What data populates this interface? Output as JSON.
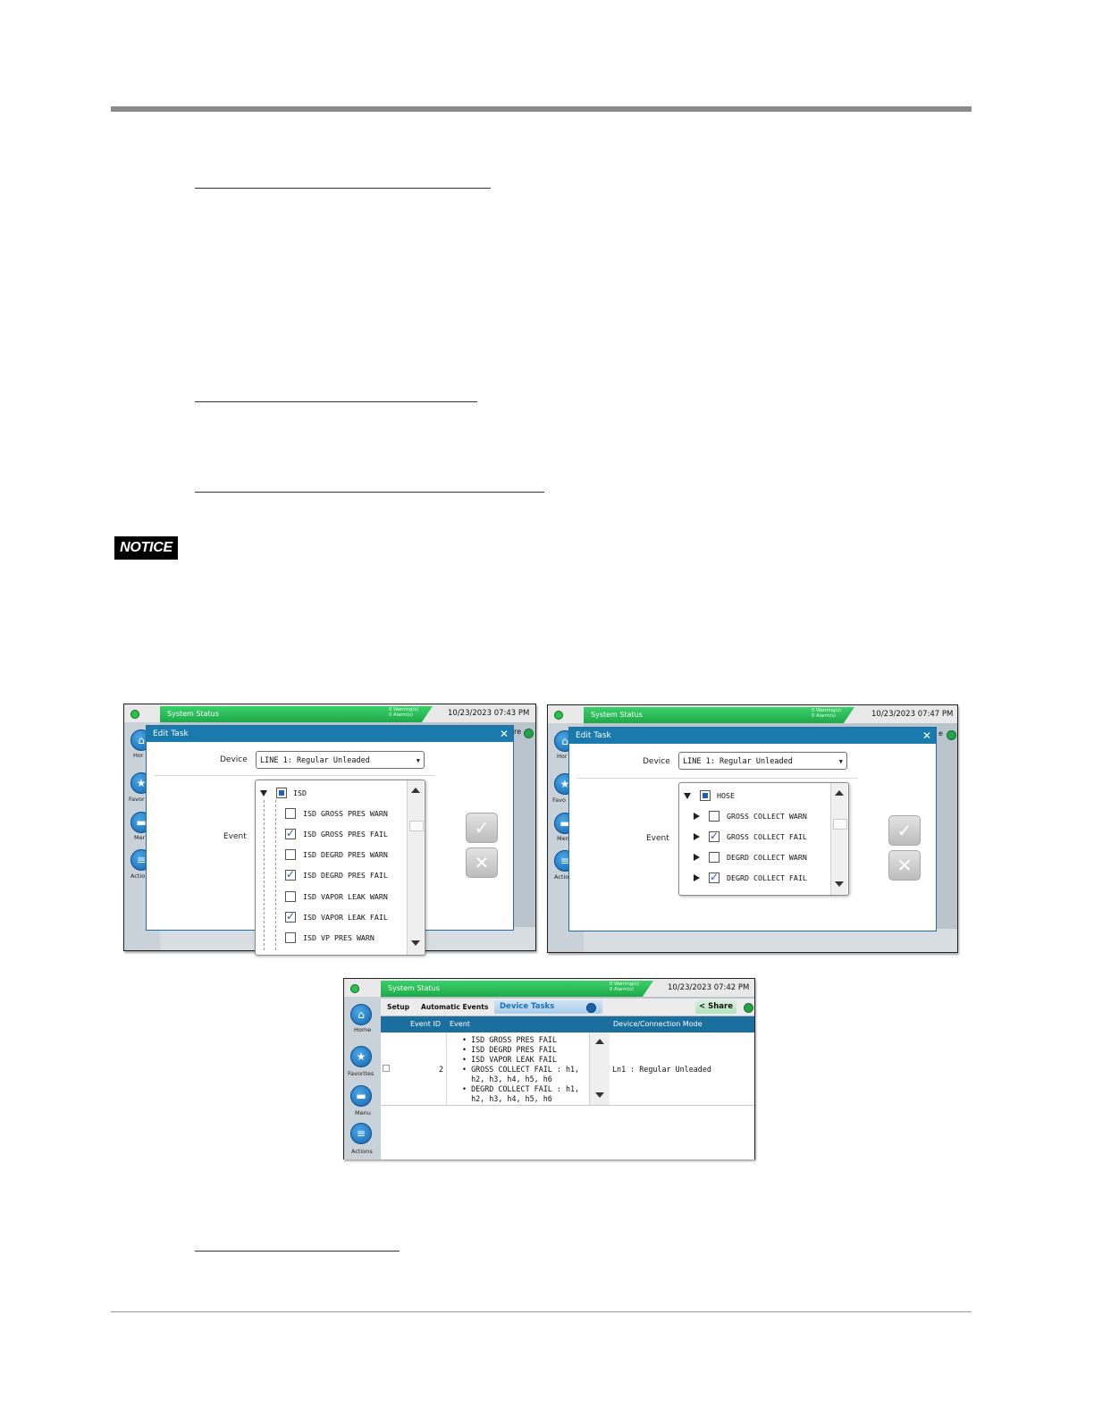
{
  "notice_label": "NOTICE",
  "screenshot_a": {
    "status_bar": {
      "title": "System Status",
      "warnings": "0 Warning(s)",
      "alarms": "0 Alarm(s)",
      "datetime": "10/23/2023 07:43 PM"
    },
    "sidebar": {
      "home": "Hor",
      "favorites": "Favor",
      "menu": "Mer",
      "actions": "Actio"
    },
    "behind_text": "re",
    "dialog": {
      "title": "Edit Task",
      "device_label": "Device",
      "device_value": "LINE 1: Regular Unleaded",
      "event_label": "Event",
      "tree": {
        "root": {
          "label": "ISD",
          "checked": "full"
        },
        "items": [
          {
            "label": "ISD GROSS PRES WARN",
            "checked": false
          },
          {
            "label": "ISD GROSS PRES FAIL",
            "checked": true
          },
          {
            "label": "ISD DEGRD PRES WARN",
            "checked": false
          },
          {
            "label": "ISD DEGRD PRES FAIL",
            "checked": true
          },
          {
            "label": "ISD VAPOR LEAK WARN",
            "checked": false
          },
          {
            "label": "ISD VAPOR LEAK FAIL",
            "checked": true
          },
          {
            "label": "ISD VP PRES WARN",
            "checked": false
          }
        ]
      },
      "confirm_icon": "check-icon",
      "cancel_icon": "x-icon"
    }
  },
  "screenshot_b": {
    "status_bar": {
      "title": "System Status",
      "warnings": "0 Warning(s)",
      "alarms": "0 Alarm(s)",
      "datetime": "10/23/2023 07:47 PM"
    },
    "sidebar": {
      "home": "Hor",
      "favorites": "Favo",
      "menu": "Men",
      "actions": "Actio"
    },
    "behind_text": "e",
    "dialog": {
      "title": "Edit Task",
      "device_label": "Device",
      "device_value": "LINE 1: Regular Unleaded",
      "event_label": "Event",
      "tree": {
        "root": {
          "label": "HOSE",
          "checked": "full"
        },
        "items": [
          {
            "label": "GROSS COLLECT WARN",
            "checked": false
          },
          {
            "label": "GROSS COLLECT FAIL",
            "checked": true
          },
          {
            "label": "DEGRD COLLECT WARN",
            "checked": false
          },
          {
            "label": "DEGRD COLLECT FAIL",
            "checked": true
          }
        ]
      },
      "confirm_icon": "check-icon",
      "cancel_icon": "x-icon"
    }
  },
  "screenshot_c": {
    "status_bar": {
      "title": "System Status",
      "warnings": "0 Warning(s)",
      "alarms": "0 Alarm(s)",
      "datetime": "10/23/2023 07:42 PM"
    },
    "sidebar": {
      "home": "Home",
      "favorites": "Favorites",
      "menu": "Menu",
      "actions": "Actions"
    },
    "tabs": {
      "setup": "Setup",
      "automatic_events": "Automatic Events",
      "device_tasks": "Device Tasks",
      "share": "Share"
    },
    "table": {
      "headers": {
        "event_id": "Event ID",
        "event": "Event",
        "device_mode": "Device/Connection Mode"
      },
      "rows": [
        {
          "event_id": "2",
          "events": [
            "• ISD GROSS PRES FAIL",
            "• ISD DEGRD PRES FAIL",
            "• ISD VAPOR LEAK FAIL",
            "• GROSS COLLECT FAIL : h1,",
            "  h2, h3, h4, h5, h6",
            "• DEGRD COLLECT FAIL : h1,",
            "  h2, h3, h4, h5, h6"
          ],
          "device_mode": "Ln1 : Regular Unleaded"
        }
      ]
    }
  }
}
